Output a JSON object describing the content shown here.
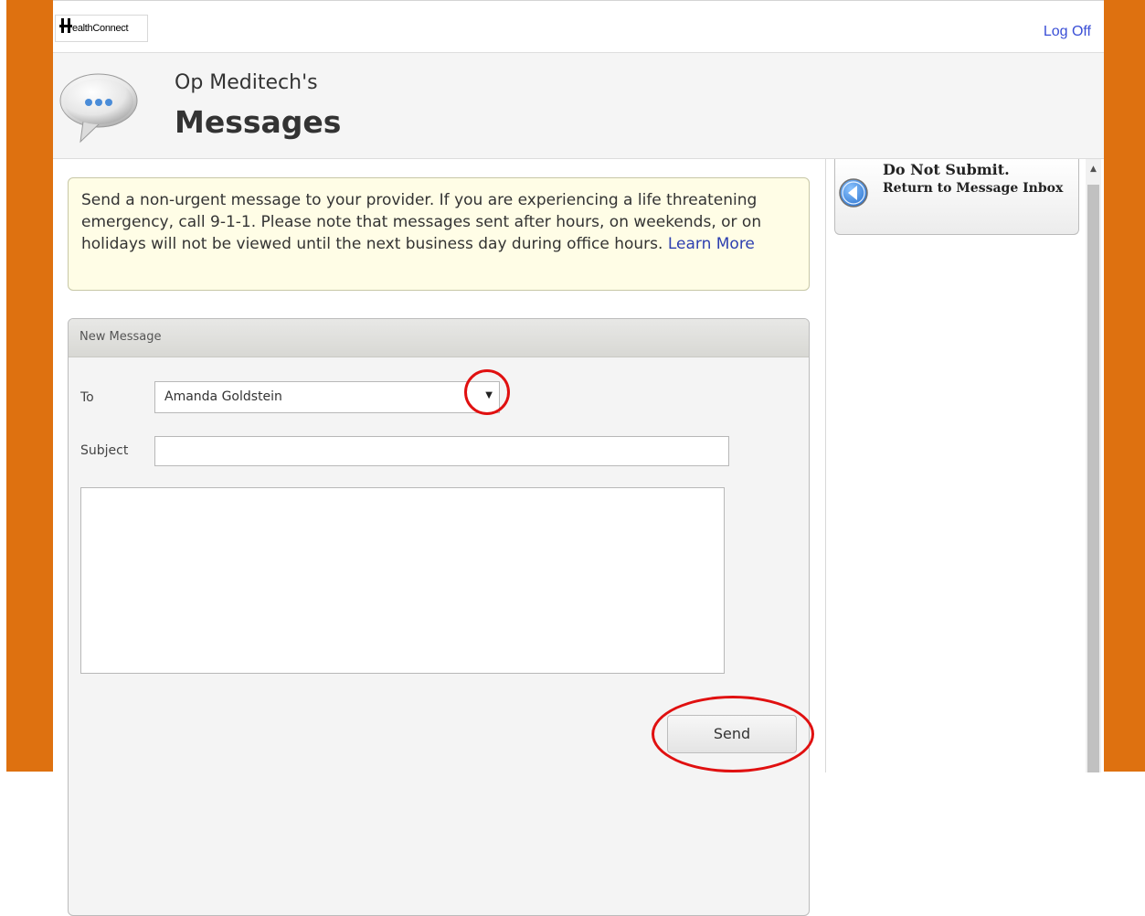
{
  "brand": {
    "logo_text": "ealthConnect"
  },
  "topbar": {
    "logoff_label": "Log Off"
  },
  "header": {
    "owner": "Op Meditech's",
    "title": "Messages"
  },
  "notice": {
    "text": "Send a non-urgent message to your provider. If you are experiencing a life threatening emergency, call 9-1-1. Please note that messages sent after hours, on weekends, or on holidays will not be viewed until the next business day during office hours.",
    "link_label": "Learn More"
  },
  "form": {
    "panel_title": "New Message",
    "to_label": "To",
    "to_value": "Amanda Goldstein",
    "subject_label": "Subject",
    "subject_value": "",
    "body_value": "",
    "send_label": "Send"
  },
  "sidebar": {
    "return_title": "Do Not Submit.",
    "return_subtitle": "Return to Message Inbox"
  },
  "colors": {
    "frame": "#de7110",
    "link": "#3a4fd6",
    "notice_bg": "#fffde6",
    "highlight_ring": "#e01010",
    "arrow_icon": "#3d8fe0"
  },
  "icons": [
    "healthconnect-logo-icon",
    "speech-bubble-icon",
    "dropdown-caret-icon",
    "back-arrow-icon",
    "scroll-up-icon"
  ]
}
